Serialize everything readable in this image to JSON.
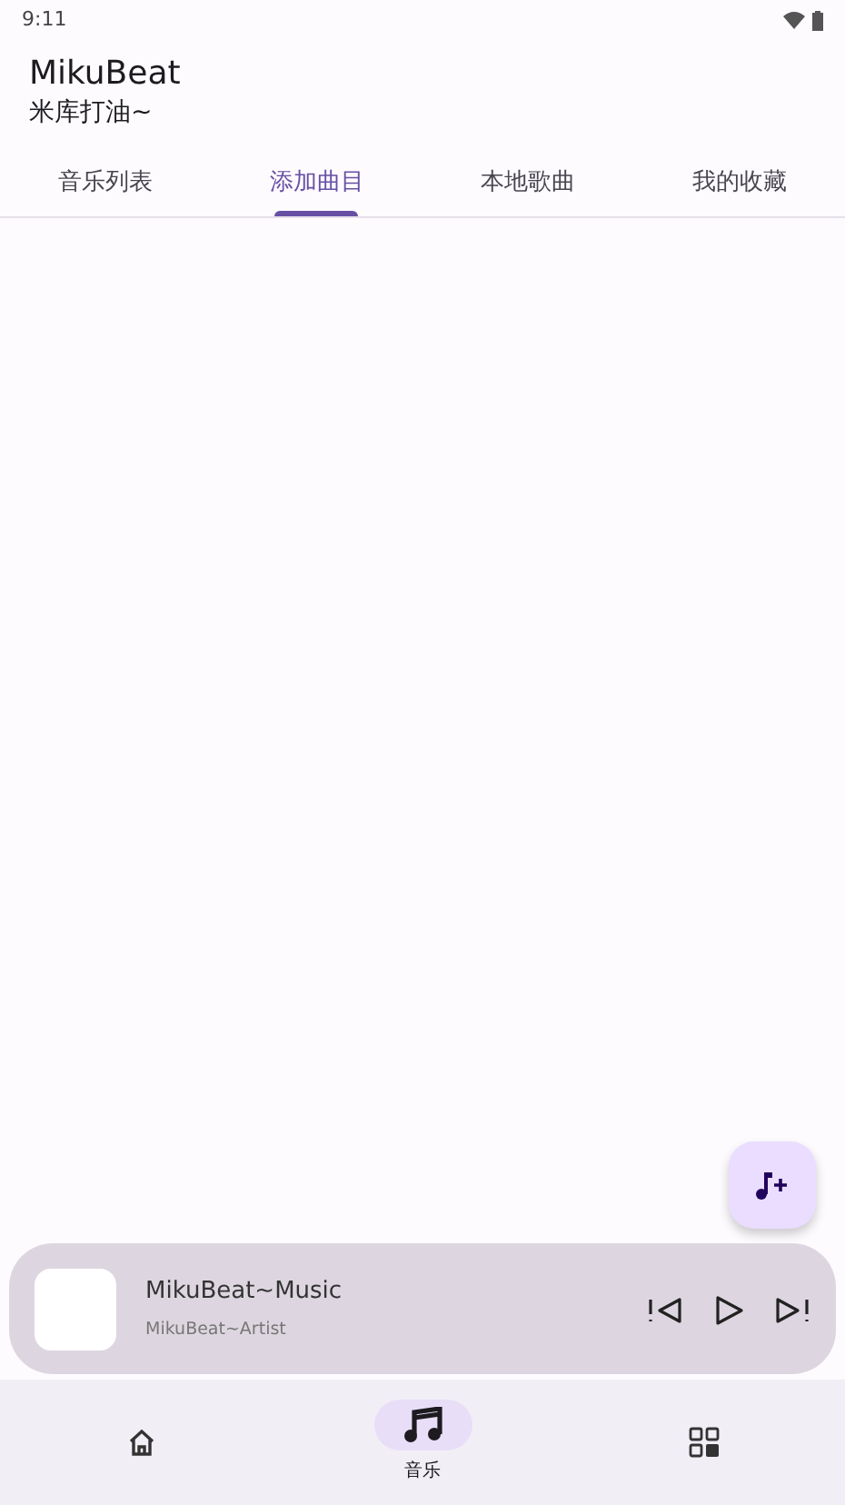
{
  "status_bar": {
    "time": "9:11"
  },
  "app_bar": {
    "title": "MikuBeat",
    "subtitle": "米库打油~"
  },
  "tabs": [
    {
      "label": "音乐列表",
      "selected": false
    },
    {
      "label": "添加曲目",
      "selected": true
    },
    {
      "label": "本地歌曲",
      "selected": false
    },
    {
      "label": "我的收藏",
      "selected": false
    }
  ],
  "now_playing": {
    "title": "MikuBeat~Music",
    "artist": "MikuBeat~Artist"
  },
  "bottom_nav": [
    {
      "kind": "home",
      "selected": false
    },
    {
      "kind": "music",
      "label": "音乐",
      "selected": true
    },
    {
      "kind": "apps",
      "selected": false
    }
  ]
}
